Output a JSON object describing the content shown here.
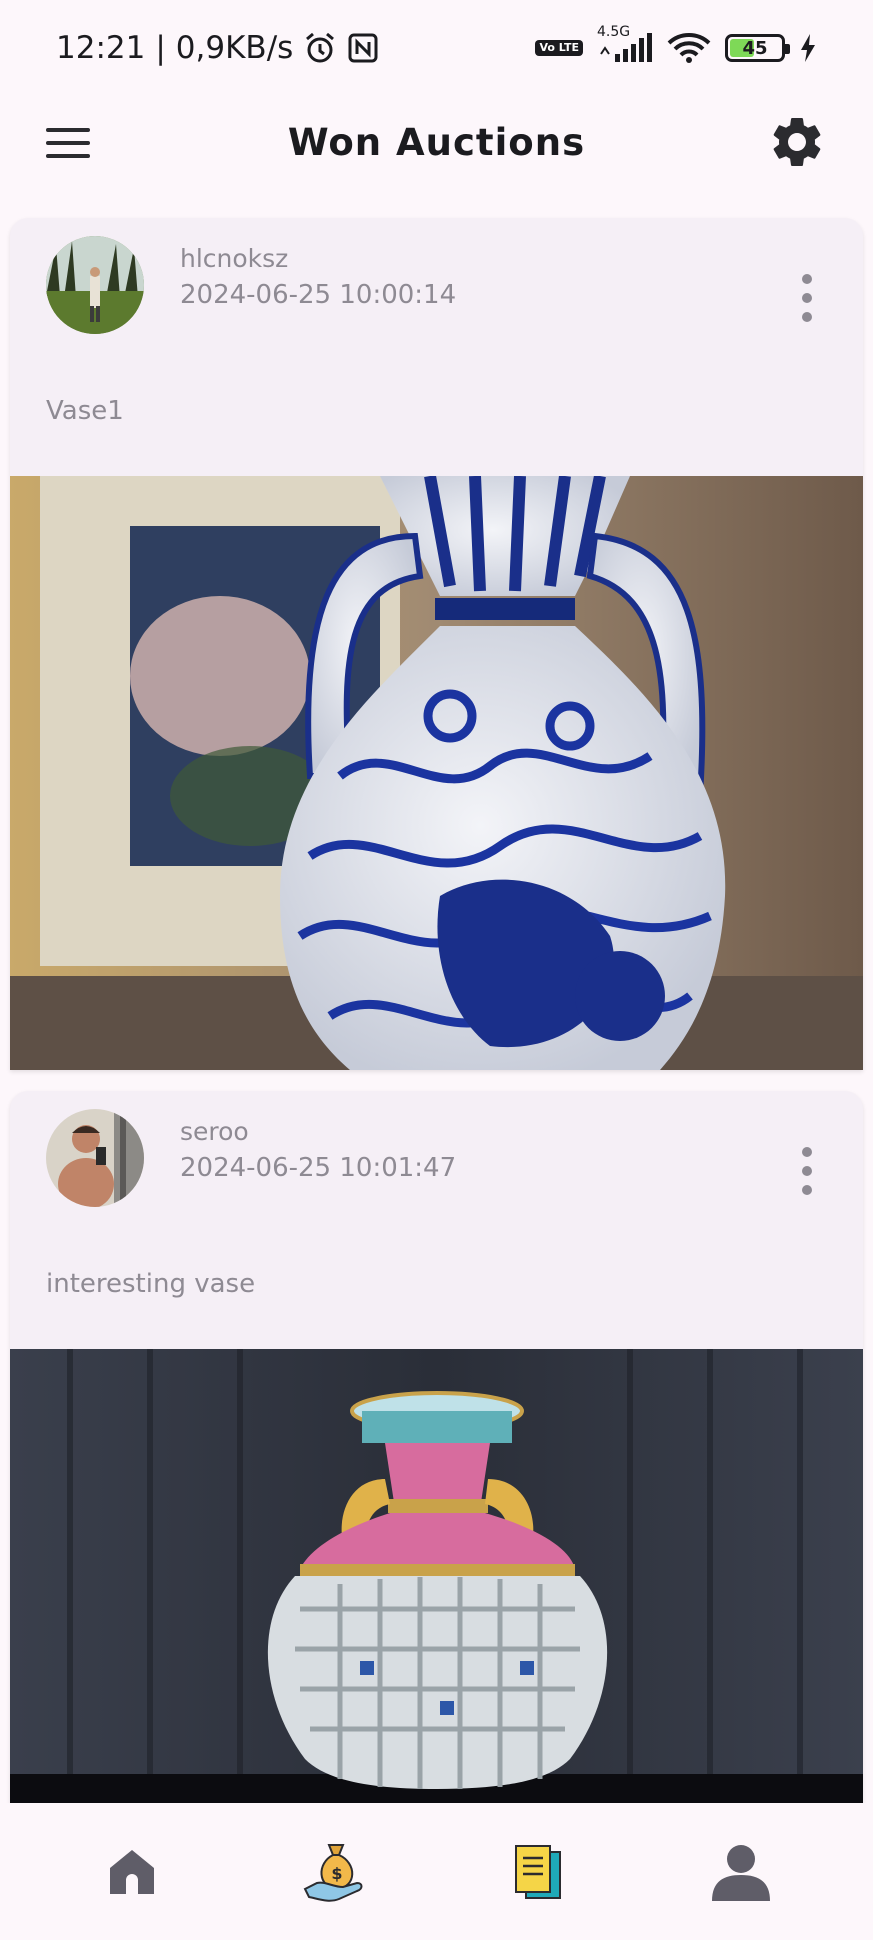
{
  "status_bar": {
    "time": "12:21",
    "separator": "|",
    "network_speed": "0,9KB/s",
    "icons": [
      "alarm-icon",
      "nfc-icon",
      "volte-icon",
      "signal-icon",
      "wifi-icon",
      "battery-icon",
      "charging-icon"
    ],
    "volte_label": "Vo LTE",
    "network_type": "4.5G",
    "battery_level": "45",
    "battery_fraction": 0.45
  },
  "app_bar": {
    "title": "Won Auctions",
    "left_icon": "menu-icon",
    "right_icon": "settings-icon"
  },
  "posts": [
    {
      "username": "hlcnoksz",
      "timestamp": "2024-06-25 10:00:14",
      "description": "Vase1",
      "image": "blue-white-vase-photo"
    },
    {
      "username": "seroo",
      "timestamp": "2024-06-25 10:01:47",
      "description": "interesting vase",
      "image": "famille-rose-vase-photo"
    }
  ],
  "bottom_nav": {
    "items": [
      "home-icon",
      "auction-money-bag-icon",
      "documents-icon",
      "profile-icon"
    ]
  },
  "colors": {
    "background": "#fdf7fb",
    "card": "#f5eff6",
    "muted_text": "#8e8a93",
    "nav_icon": "#5f5d68",
    "docs_yellow": "#f5d547",
    "docs_teal": "#1fa9b8"
  }
}
